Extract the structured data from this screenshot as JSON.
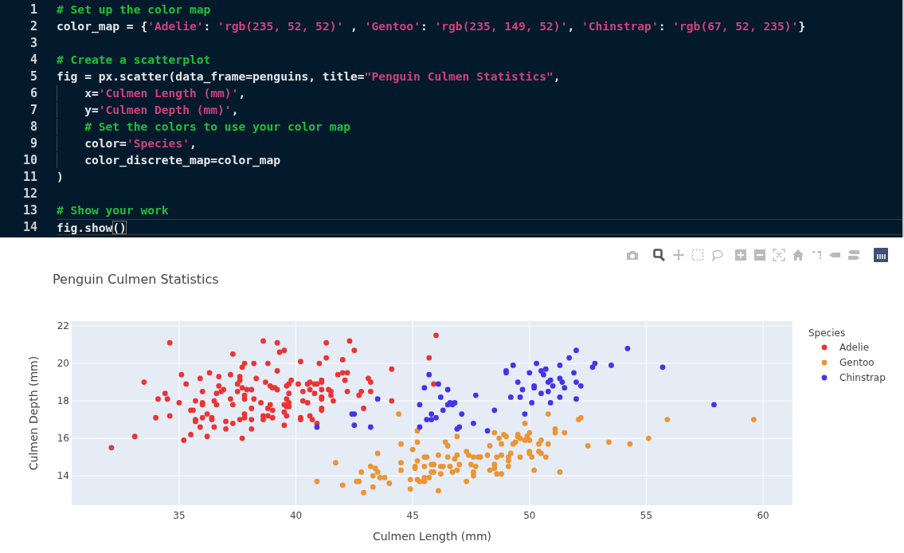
{
  "editor": {
    "lines": [
      {
        "number": "1",
        "current": false,
        "tokens": [
          {
            "kind": "comment",
            "text": "# Set up the color map"
          }
        ]
      },
      {
        "number": "2",
        "current": false,
        "tokens": [
          {
            "kind": "plain",
            "text": "color_map = {"
          },
          {
            "kind": "string",
            "text": "'Adelie'"
          },
          {
            "kind": "plain",
            "text": ": "
          },
          {
            "kind": "string",
            "text": "'rgb(235, 52, 52)'"
          },
          {
            "kind": "plain",
            "text": " , "
          },
          {
            "kind": "string",
            "text": "'Gentoo'"
          },
          {
            "kind": "plain",
            "text": ": "
          },
          {
            "kind": "string",
            "text": "'rgb(235, 149, 52)'"
          },
          {
            "kind": "plain",
            "text": ", "
          },
          {
            "kind": "string",
            "text": "'Chinstrap'"
          },
          {
            "kind": "plain",
            "text": ": "
          },
          {
            "kind": "string",
            "text": "'rgb(67, 52, 235)'"
          },
          {
            "kind": "plain",
            "text": "}"
          }
        ]
      },
      {
        "number": "3",
        "current": false
      },
      {
        "number": "4",
        "current": false,
        "tokens": [
          {
            "kind": "comment",
            "text": "# Create a scatterplot"
          }
        ]
      },
      {
        "number": "5",
        "current": false,
        "tokens": [
          {
            "kind": "plain",
            "text": "fig = px.scatter(data_frame=penguins, title="
          },
          {
            "kind": "string",
            "text": "\"Penguin Culmen Statistics\""
          },
          {
            "kind": "plain",
            "text": ","
          }
        ]
      },
      {
        "number": "6",
        "current": false,
        "tokens": [
          {
            "kind": "plain",
            "text": "    x="
          },
          {
            "kind": "string",
            "text": "'Culmen Length (mm)'"
          },
          {
            "kind": "plain",
            "text": ","
          }
        ]
      },
      {
        "number": "7",
        "current": false,
        "tokens": [
          {
            "kind": "plain",
            "text": "    y="
          },
          {
            "kind": "string",
            "text": "'Culmen Depth (mm)'"
          },
          {
            "kind": "plain",
            "text": ","
          }
        ]
      },
      {
        "number": "8",
        "current": false,
        "tokens": [
          {
            "kind": "comment",
            "text": "    # Set the colors to use your color map"
          }
        ]
      },
      {
        "number": "9",
        "current": false,
        "tokens": [
          {
            "kind": "plain",
            "text": "    color="
          },
          {
            "kind": "string",
            "text": "'Species'"
          },
          {
            "kind": "plain",
            "text": ","
          }
        ]
      },
      {
        "number": "10",
        "current": false,
        "tokens": [
          {
            "kind": "plain",
            "text": "    color_discrete_map=color_map"
          }
        ]
      },
      {
        "number": "11",
        "current": false,
        "tokens": [
          {
            "kind": "plain",
            "text": ")"
          }
        ]
      },
      {
        "number": "12",
        "current": false
      },
      {
        "number": "13",
        "current": false,
        "tokens": [
          {
            "kind": "comment",
            "text": "# Show your work"
          }
        ]
      },
      {
        "number": "14",
        "current": true,
        "tokens": [
          {
            "kind": "plain",
            "text": "fig.show"
          },
          {
            "kind": "bracket",
            "text": "()"
          }
        ]
      }
    ]
  },
  "modebar": [
    {
      "kind": "camera",
      "selected": false
    },
    {
      "kind": "zoom",
      "selected": true
    },
    {
      "kind": "pan",
      "selected": false
    },
    {
      "kind": "box-select",
      "selected": false
    },
    {
      "kind": "lasso",
      "selected": false
    },
    {
      "kind": "zoom-in",
      "selected": false
    },
    {
      "kind": "zoom-out",
      "selected": false
    },
    {
      "kind": "autoscale",
      "selected": false
    },
    {
      "kind": "home",
      "selected": false
    },
    {
      "kind": "spikes",
      "selected": false
    },
    {
      "kind": "hover-closest",
      "selected": false
    },
    {
      "kind": "hover-compare",
      "selected": false
    },
    {
      "kind": "logo"
    }
  ],
  "plot": {
    "legend_title": "Species",
    "chart_data": {
      "type": "scatter",
      "title": "Penguin Culmen Statistics",
      "xlabel": "Culmen Length (mm)",
      "ylabel": "Culmen Depth (mm)",
      "xlim": [
        30.4,
        61.26
      ],
      "ylim": [
        12.43,
        22.26
      ],
      "xticks": [
        35,
        40,
        45,
        50,
        55,
        60
      ],
      "yticks": [
        14,
        16,
        18,
        20,
        22
      ],
      "grid": true,
      "legend": "right",
      "series": [
        {
          "name": "Adelie",
          "color": "#eb3434",
          "x": [
            32.1,
            33.1,
            33.5,
            34.0,
            34.1,
            34.4,
            34.5,
            34.6,
            34.6,
            35.0,
            35.1,
            35.2,
            35.3,
            35.5,
            35.5,
            35.6,
            35.7,
            35.7,
            35.7,
            35.9,
            35.9,
            36.0,
            36.0,
            36.0,
            36.0,
            36.2,
            36.2,
            36.3,
            36.4,
            36.4,
            36.5,
            36.5,
            36.6,
            36.6,
            36.7,
            36.7,
            36.8,
            36.9,
            37.0,
            37.0,
            37.2,
            37.2,
            37.3,
            37.3,
            37.3,
            37.5,
            37.5,
            37.6,
            37.6,
            37.6,
            37.7,
            37.7,
            37.7,
            37.8,
            37.8,
            37.8,
            37.8,
            37.8,
            37.9,
            38.1,
            38.1,
            38.1,
            38.1,
            38.2,
            38.2,
            38.3,
            38.5,
            38.6,
            38.6,
            38.6,
            38.7,
            38.8,
            38.8,
            38.8,
            38.9,
            38.9,
            39.0,
            39.0,
            39.0,
            39.1,
            39.2,
            39.2,
            39.2,
            39.3,
            39.5,
            39.5,
            39.5,
            39.5,
            39.6,
            39.6,
            39.6,
            39.6,
            39.7,
            39.7,
            39.7,
            39.7,
            39.8,
            40.1,
            40.2,
            40.2,
            40.2,
            40.3,
            40.3,
            40.5,
            40.5,
            40.6,
            40.6,
            40.6,
            40.7,
            40.8,
            40.8,
            40.9,
            40.9,
            41.0,
            41.1,
            41.1,
            41.1,
            41.1,
            41.1,
            41.1,
            41.1,
            41.3,
            41.3,
            41.4,
            41.5,
            41.5,
            41.6,
            41.8,
            42.0,
            42.0,
            42.1,
            42.2,
            42.2,
            42.3,
            42.5,
            42.7,
            42.8,
            42.9,
            43.1,
            43.2,
            43.2,
            44.1,
            44.1,
            45.7,
            45.9,
            46.0
          ],
          "values": [
            15.5,
            16.1,
            19.0,
            17.1,
            18.1,
            18.4,
            18.1,
            21.1,
            17.2,
            17.9,
            19.4,
            15.9,
            18.9,
            16.2,
            17.5,
            17.5,
            18.0,
            17.0,
            16.9,
            16.6,
            19.2,
            18.5,
            17.9,
            17.8,
            17.1,
            16.1,
            17.3,
            19.5,
            17.1,
            17.0,
            16.6,
            18.0,
            18.4,
            17.8,
            19.3,
            18.8,
            18.5,
            18.6,
            16.9,
            16.5,
            19.4,
            18.1,
            20.5,
            16.8,
            17.8,
            18.9,
            18.5,
            19.3,
            19.1,
            17.0,
            19.8,
            18.7,
            16.0,
            20.0,
            18.3,
            18.1,
            17.3,
            17.1,
            18.6,
            18.6,
            17.6,
            17.0,
            16.5,
            20.0,
            18.1,
            19.2,
            17.9,
            21.2,
            17.2,
            17.0,
            19.0,
            20.0,
            17.6,
            17.2,
            18.8,
            17.8,
            18.7,
            17.5,
            17.1,
            18.7,
            21.1,
            19.6,
            18.6,
            20.6,
            20.7,
            17.4,
            16.7,
            17.8,
            18.8,
            18.1,
            17.2,
            17.7,
            18.4,
            18.9,
            17.9,
            17.7,
            19.1,
            18.9,
            20.1,
            17.1,
            17.0,
            18.5,
            18.0,
            17.9,
            18.9,
            19.0,
            18.6,
            17.2,
            17.0,
            18.4,
            18.9,
            16.8,
            18.9,
            20.0,
            19.1,
            19.0,
            18.6,
            18.1,
            18.2,
            17.6,
            17.5,
            21.1,
            20.3,
            18.6,
            18.5,
            18.3,
            18.0,
            19.4,
            20.2,
            19.5,
            19.1,
            19.5,
            18.5,
            21.2,
            20.7,
            18.3,
            18.5,
            17.6,
            19.2,
            19.0,
            18.5,
            19.7,
            18.0,
            20.3,
            18.9,
            21.5
          ]
        },
        {
          "name": "Gentoo",
          "color": "#eb9534",
          "x": [
            40.9,
            41.7,
            42.0,
            42.6,
            42.7,
            42.8,
            42.9,
            43.2,
            43.3,
            43.3,
            43.4,
            43.5,
            43.5,
            43.6,
            43.8,
            44.0,
            44.4,
            44.5,
            44.5,
            44.5,
            44.9,
            44.9,
            45.0,
            45.1,
            45.1,
            45.2,
            45.2,
            45.2,
            45.2,
            45.3,
            45.5,
            45.5,
            45.5,
            45.5,
            45.6,
            45.7,
            45.8,
            45.8,
            45.9,
            45.9,
            46.1,
            46.1,
            46.2,
            46.2,
            46.3,
            46.4,
            46.5,
            46.5,
            46.6,
            46.7,
            46.8,
            46.9,
            46.9,
            46.9,
            47.0,
            47.3,
            47.3,
            47.4,
            47.5,
            47.6,
            47.6,
            47.6,
            47.7,
            47.8,
            47.9,
            48.2,
            48.3,
            48.3,
            48.5,
            48.5,
            48.5,
            48.6,
            48.6,
            48.7,
            48.8,
            48.8,
            48.8,
            48.9,
            49.0,
            49.1,
            49.1,
            49.1,
            49.2,
            49.3,
            49.4,
            49.5,
            49.5,
            49.6,
            49.6,
            49.8,
            49.8,
            49.9,
            50.0,
            50.0,
            50.0,
            50.0,
            50.1,
            50.2,
            50.4,
            50.4,
            50.5,
            50.5,
            50.7,
            50.8,
            50.8,
            51.1,
            51.1,
            51.3,
            51.5,
            52.1,
            52.2,
            52.5,
            53.4,
            54.3,
            55.1,
            55.9,
            59.6
          ],
          "values": [
            13.7,
            14.7,
            13.5,
            13.7,
            13.7,
            14.2,
            13.1,
            14.5,
            14.0,
            13.4,
            14.4,
            14.2,
            15.2,
            13.9,
            13.9,
            13.6,
            17.3,
            15.7,
            14.7,
            14.3,
            13.8,
            13.3,
            15.4,
            14.5,
            14.4,
            16.4,
            15.8,
            14.8,
            13.8,
            13.7,
            15.0,
            14.5,
            13.9,
            13.7,
            15.0,
            13.9,
            14.6,
            14.2,
            14.6,
            14.2,
            15.1,
            13.2,
            14.1,
            14.5,
            14.5,
            15.8,
            15.6,
            15.0,
            14.5,
            14.2,
            14.9,
            16.1,
            15.1,
            14.3,
            14.6,
            15.3,
            13.7,
            15.1,
            14.6,
            15.0,
            14.2,
            14.0,
            14.5,
            15.0,
            15.0,
            15.1,
            15.6,
            14.3,
            16.3,
            14.6,
            14.4,
            15.0,
            14.1,
            16.0,
            15.7,
            15.1,
            14.1,
            16.2,
            16.1,
            15.0,
            14.8,
            14.5,
            15.2,
            15.7,
            15.8,
            16.2,
            16.1,
            16.0,
            15.0,
            16.8,
            15.9,
            16.1,
            16.3,
            15.9,
            15.3,
            15.2,
            15.0,
            14.3,
            15.3,
            15.7,
            15.9,
            15.2,
            15.0,
            17.3,
            15.7,
            16.5,
            16.3,
            14.2,
            16.3,
            17.0,
            17.1,
            15.6,
            15.8,
            15.7,
            16.0,
            17.0,
            17.0
          ]
        },
        {
          "name": "Chinstrap",
          "color": "#4334eb",
          "x": [
            40.9,
            42.4,
            42.5,
            42.5,
            43.2,
            43.5,
            45.3,
            45.3,
            45.5,
            45.6,
            45.7,
            45.8,
            45.8,
            46.0,
            46.1,
            46.2,
            46.3,
            46.5,
            46.5,
            46.6,
            46.7,
            46.8,
            46.9,
            47.0,
            47.1,
            47.6,
            47.7,
            48.2,
            48.5,
            49.0,
            49.0,
            49.2,
            49.3,
            49.5,
            49.6,
            49.7,
            49.8,
            50.0,
            50.1,
            50.2,
            50.2,
            50.3,
            50.5,
            50.5,
            50.6,
            50.7,
            50.8,
            50.8,
            50.9,
            50.9,
            51.0,
            51.3,
            51.3,
            51.3,
            51.4,
            51.5,
            51.7,
            51.9,
            52.0,
            52.0,
            52.0,
            52.2,
            52.7,
            52.8,
            53.5,
            54.2,
            55.7,
            57.9
          ],
          "values": [
            16.6,
            17.3,
            17.3,
            16.7,
            16.6,
            18.1,
            17.8,
            16.6,
            18.7,
            17.0,
            19.4,
            17.0,
            17.3,
            17.1,
            18.9,
            18.2,
            17.5,
            18.6,
            17.8,
            17.9,
            17.8,
            17.9,
            16.5,
            16.6,
            17.3,
            16.8,
            18.3,
            16.4,
            17.5,
            19.6,
            19.5,
            18.2,
            19.9,
            19.0,
            18.2,
            18.6,
            17.3,
            19.5,
            17.9,
            18.8,
            18.7,
            20.0,
            19.6,
            18.4,
            19.4,
            19.7,
            19.0,
            18.5,
            19.1,
            17.9,
            18.8,
            19.9,
            19.2,
            18.2,
            19.0,
            18.7,
            20.3,
            19.5,
            20.7,
            19.0,
            18.1,
            18.8,
            19.8,
            20.0,
            19.9,
            20.8,
            19.8,
            17.8
          ]
        }
      ]
    }
  }
}
